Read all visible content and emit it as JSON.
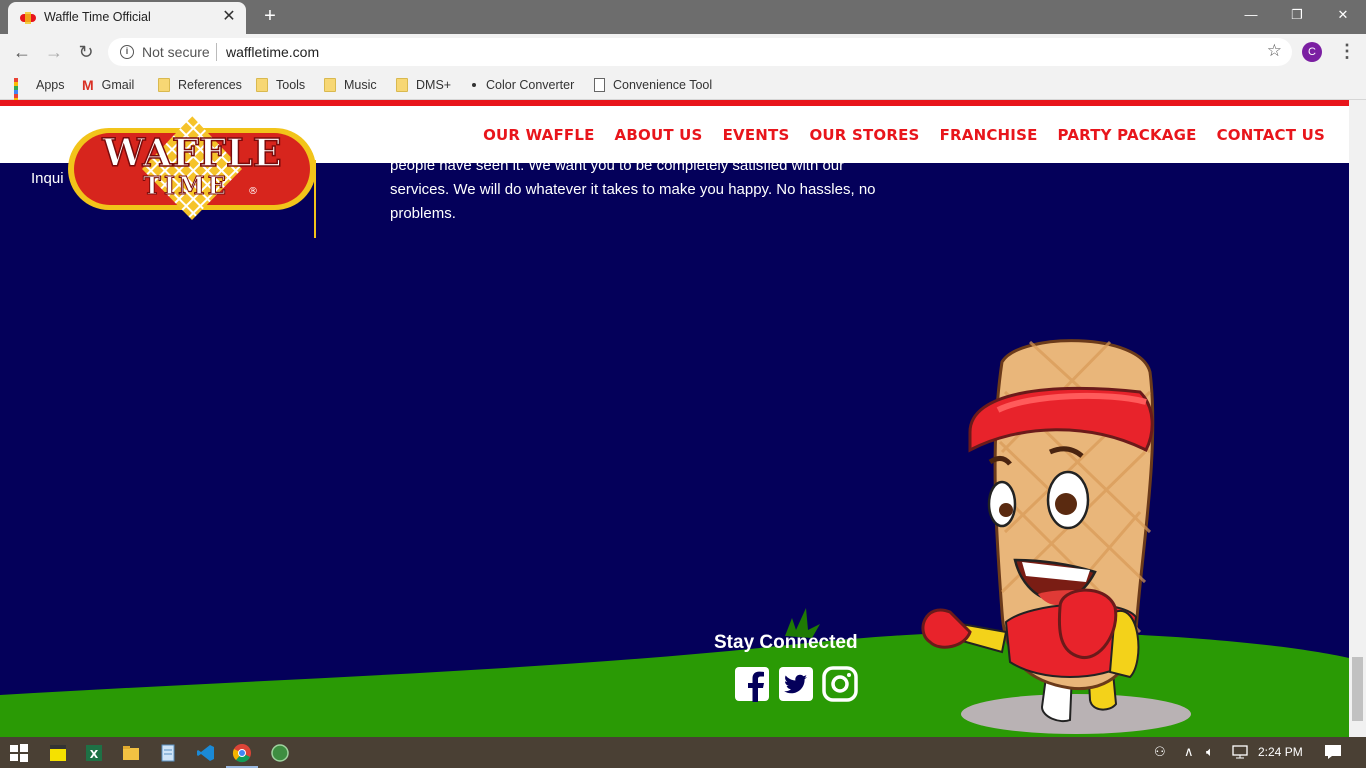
{
  "browser": {
    "tab_title": "Waffle Time Official",
    "tab_close": "✕",
    "new_tab": "+",
    "window_controls": {
      "minimize": "—",
      "restore": "❐",
      "close": "✕"
    },
    "back": "←",
    "forward": "→",
    "reload": "↻",
    "security_label": "Not secure",
    "url": "waffletime.com",
    "profile_initial": "C",
    "star": "☆",
    "menu": "⋮",
    "bookmarks": [
      {
        "label": "Apps",
        "icon": "apps-grid-icon"
      },
      {
        "label": "Gmail",
        "icon": "gmail-icon"
      },
      {
        "label": "References",
        "icon": "folder-icon"
      },
      {
        "label": "Tools",
        "icon": "folder-icon"
      },
      {
        "label": "Music",
        "icon": "folder-icon"
      },
      {
        "label": "DMS+",
        "icon": "folder-icon"
      },
      {
        "label": "Color Converter",
        "icon": "dot-icon"
      },
      {
        "label": "Convenience Tool",
        "icon": "page-icon"
      }
    ]
  },
  "site": {
    "brand": {
      "line1": "WAFFLE",
      "line2": "TIME",
      "registered": "®"
    },
    "nav": [
      "OUR WAFFLE",
      "ABOUT US",
      "EVENTS",
      "OUR STORES",
      "FRANCHISE",
      "PARTY PACKAGE",
      "CONTACT US"
    ],
    "inquiry_fragment": "Inqui",
    "body_text": "people have seen it. We want you to be completely satisfied with our services. We will do whatever it takes to make you happy. No hassles, no problems.",
    "stay_connected": "Stay Connected",
    "social": [
      "facebook",
      "twitter",
      "instagram"
    ],
    "colors": {
      "navy": "#04005a",
      "red": "#e8151b",
      "grass": "#2a9a05",
      "gold": "#f2c41a"
    }
  },
  "taskbar": {
    "time": "2:24 PM"
  }
}
